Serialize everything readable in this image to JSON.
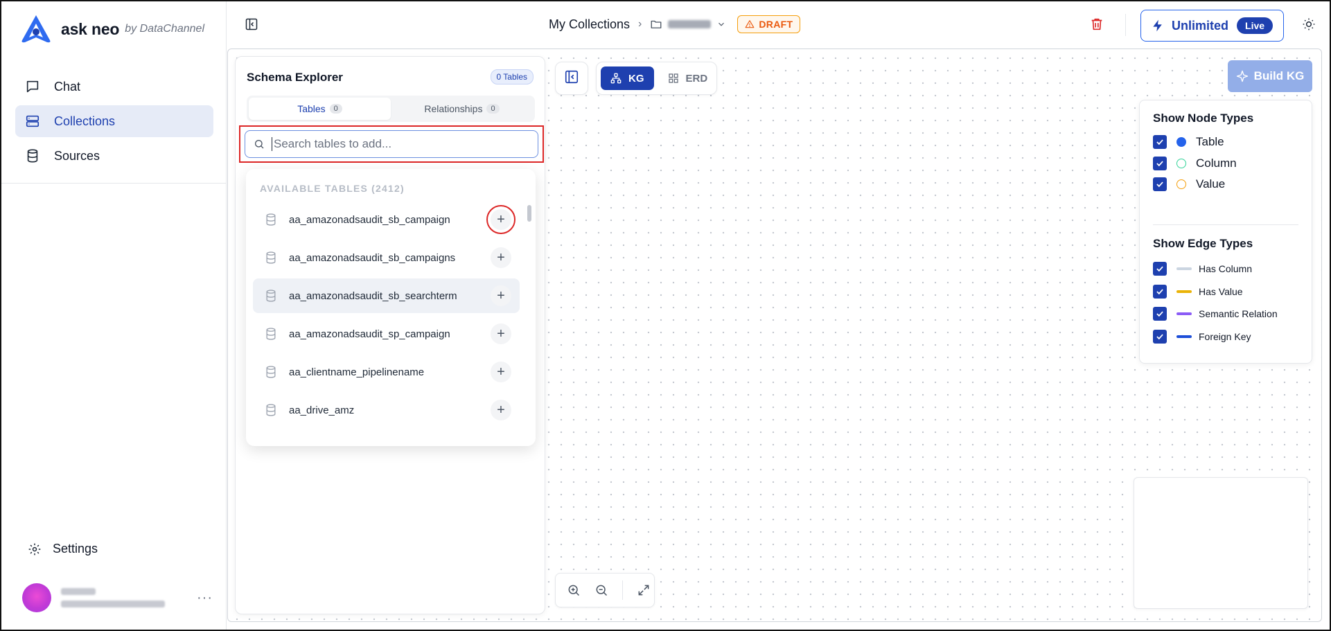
{
  "brand": {
    "name": "ask neo",
    "by": "by DataChannel"
  },
  "nav": {
    "items": [
      {
        "label": "Chat",
        "icon": "chat-icon",
        "active": false
      },
      {
        "label": "Collections",
        "icon": "collections-icon",
        "active": true
      },
      {
        "label": "Sources",
        "icon": "database-icon",
        "active": false
      }
    ],
    "settings_label": "Settings",
    "more_label": "···"
  },
  "header": {
    "breadcrumb_root": "My Collections",
    "draft_label": "DRAFT",
    "unlimited_label": "Unlimited",
    "live_label": "Live"
  },
  "schema_explorer": {
    "title": "Schema Explorer",
    "tables_count_label": "0 Tables",
    "tabs": [
      {
        "label": "Tables",
        "count": "0",
        "active": true
      },
      {
        "label": "Relationships",
        "count": "0",
        "active": false
      }
    ],
    "search": {
      "placeholder": "Search tables to add...",
      "value": ""
    },
    "available_header": "AVAILABLE TABLES (2412)",
    "tables": [
      "aa_amazonadsaudit_sb_campaign",
      "aa_amazonadsaudit_sb_campaigns",
      "aa_amazonadsaudit_sb_searchterm",
      "aa_amazonadsaudit_sp_campaign",
      "aa_clientname_pipelinename",
      "aa_drive_amz"
    ],
    "add_symbol": "+"
  },
  "toolbar": {
    "view_modes": [
      {
        "label": "KG",
        "active": true
      },
      {
        "label": "ERD",
        "active": false
      }
    ],
    "build_kg_label": "Build KG"
  },
  "legend": {
    "node_title": "Show Node Types",
    "nodes": [
      {
        "label": "Table",
        "color": "#2563eb",
        "filled": true
      },
      {
        "label": "Column",
        "color": "#34d399",
        "filled": false
      },
      {
        "label": "Value",
        "color": "#f59e0b",
        "filled": false
      }
    ],
    "edge_title": "Show Edge Types",
    "edges": [
      {
        "label": "Has Column",
        "color": "#cbd5e1"
      },
      {
        "label": "Has Value",
        "color": "#eab308"
      },
      {
        "label": "Semantic Relation",
        "color": "#8b5cf6"
      },
      {
        "label": "Foreign Key",
        "color": "#1d4ed8"
      }
    ]
  },
  "colors": {
    "accent": "#1e40af",
    "highlight": "#dc2626",
    "draft": "#ea580c"
  }
}
